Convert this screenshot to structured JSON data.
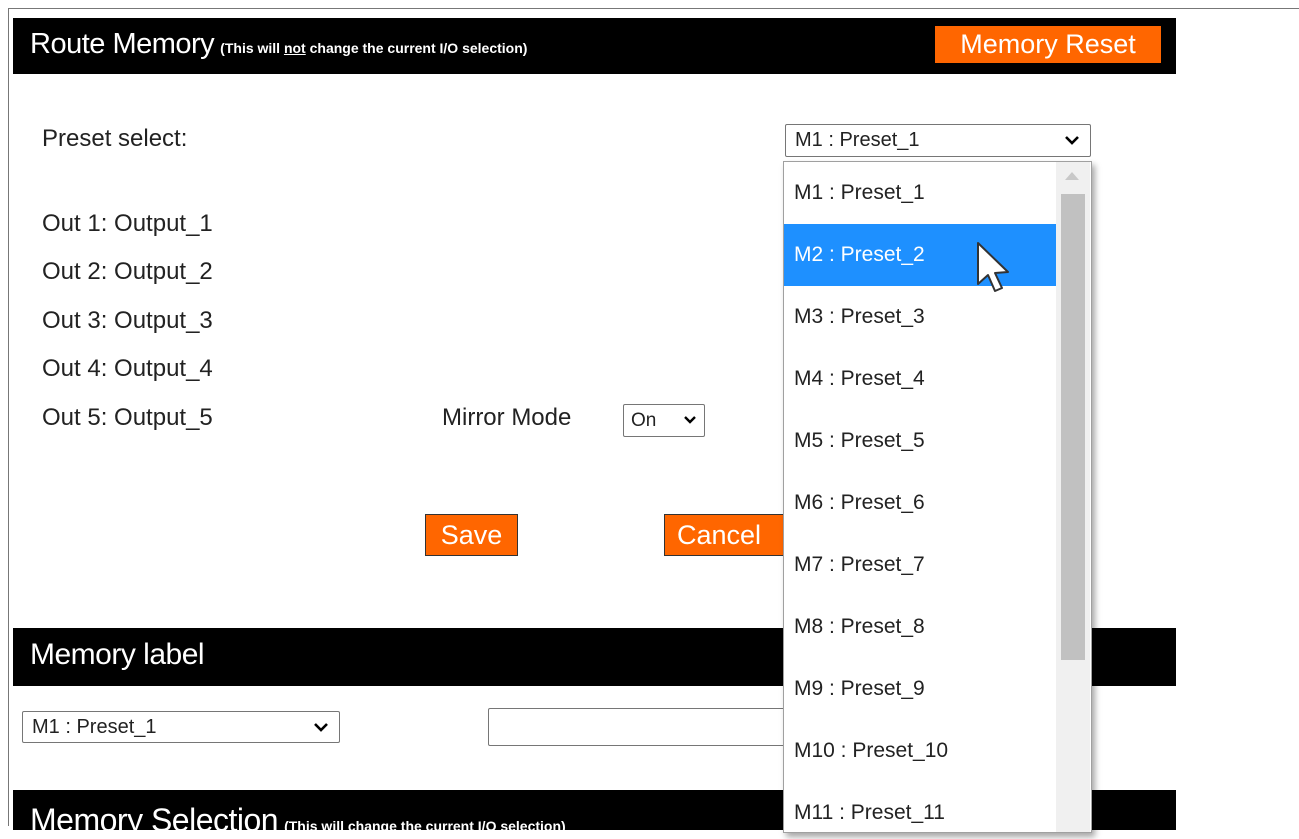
{
  "route_memory": {
    "title": "Route Memory",
    "note_prefix": "(This will ",
    "note_emph": "not",
    "note_suffix": " change the current I/O selection)",
    "reset_label": "Memory Reset"
  },
  "preset": {
    "label": "Preset select:",
    "selected": "M1 : Preset_1"
  },
  "outputs": [
    "Out 1: Output_1",
    "Out 2: Output_2",
    "Out 3: Output_3",
    "Out 4: Output_4",
    "Out 5: Output_5"
  ],
  "mirror": {
    "label": "Mirror Mode",
    "value": "On"
  },
  "actions": {
    "save_label": "Save",
    "cancel_label": "Cancel"
  },
  "memory_label": {
    "title": "Memory label",
    "selected": "M1 : Preset_1",
    "input_value": ""
  },
  "memory_selection": {
    "title": "Memory Selection",
    "note": "(This will change the current I/O selection)"
  },
  "dropdown_options": [
    "M1 : Preset_1",
    "M2 : Preset_2",
    "M3 : Preset_3",
    "M4 : Preset_4",
    "M5 : Preset_5",
    "M6 : Preset_6",
    "M7 : Preset_7",
    "M8 : Preset_8",
    "M9 : Preset_9",
    "M10 : Preset_10",
    "M11 : Preset_11"
  ],
  "dropdown_highlighted_index": 1,
  "colors": {
    "accent": "#ff6600",
    "header_bg": "#000000",
    "highlight": "#1e90ff"
  },
  "icons": {
    "select_arrow": "chevron-down-icon",
    "cursor": "mouse-pointer-icon"
  }
}
